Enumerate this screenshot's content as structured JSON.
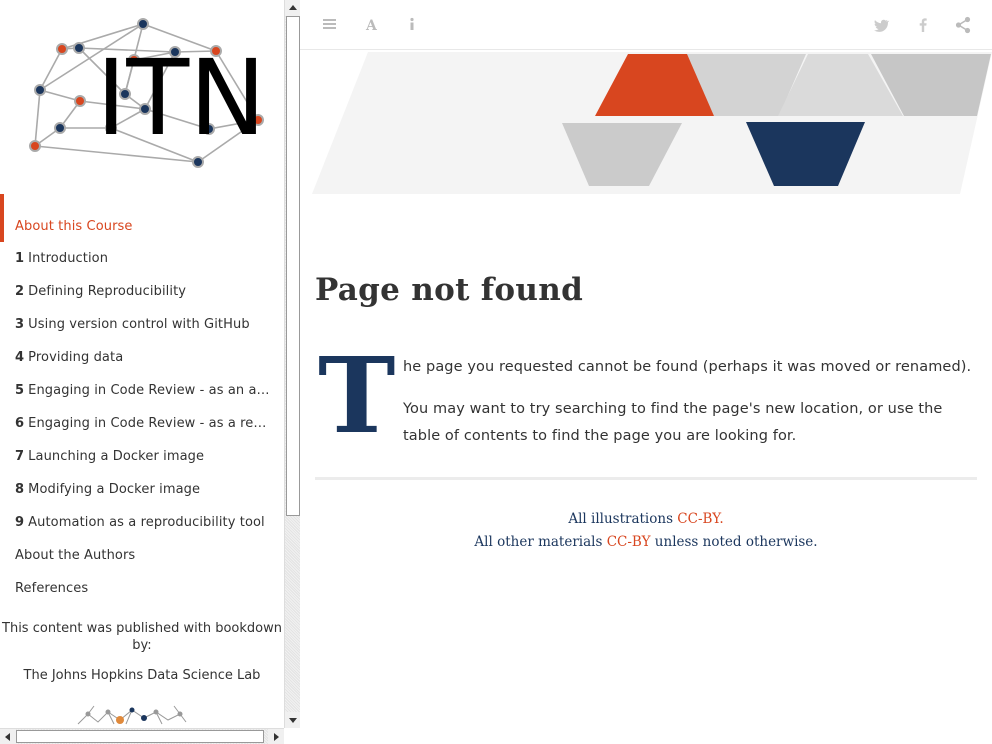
{
  "sidebar": {
    "logo_text": "ITN",
    "items": [
      {
        "number": "",
        "label": "About this Course",
        "active": true
      },
      {
        "number": "1",
        "label": "Introduction"
      },
      {
        "number": "2",
        "label": "Defining Reproducibility"
      },
      {
        "number": "3",
        "label": "Using version control with GitHub"
      },
      {
        "number": "4",
        "label": "Providing data"
      },
      {
        "number": "5",
        "label": "Engaging in Code Review - as an aut…"
      },
      {
        "number": "6",
        "label": "Engaging in Code Review - as a revie…"
      },
      {
        "number": "7",
        "label": "Launching a Docker image"
      },
      {
        "number": "8",
        "label": "Modifying a Docker image"
      },
      {
        "number": "9",
        "label": "Automation as a reproducibility tool"
      },
      {
        "number": "",
        "label": "About the Authors"
      },
      {
        "number": "",
        "label": "References"
      }
    ],
    "published_text": "This content was published with bookdown by:",
    "lab_name": "The Johns Hopkins Data Science Lab"
  },
  "toolbar": {
    "icons": [
      "menu-icon",
      "font-icon",
      "info-icon",
      "twitter-icon",
      "facebook-icon",
      "share-icon"
    ]
  },
  "main": {
    "title": "Page not found",
    "dropcap": "T",
    "para1_rest": "he page you requested cannot be found (perhaps it was moved or renamed).",
    "para2": "You may want to try searching to find the page's new location, or use the table of contents to find the page you are looking for.",
    "footer": {
      "line1_prefix": "All illustrations ",
      "line1_link": "CC-BY.",
      "line2_prefix": "All other materials ",
      "line2_link": "CC-BY",
      "line2_suffix": " unless noted otherwise."
    }
  },
  "colors": {
    "accent": "#d8461f",
    "navy": "#1b365d",
    "gray": "#c8c8c8"
  }
}
